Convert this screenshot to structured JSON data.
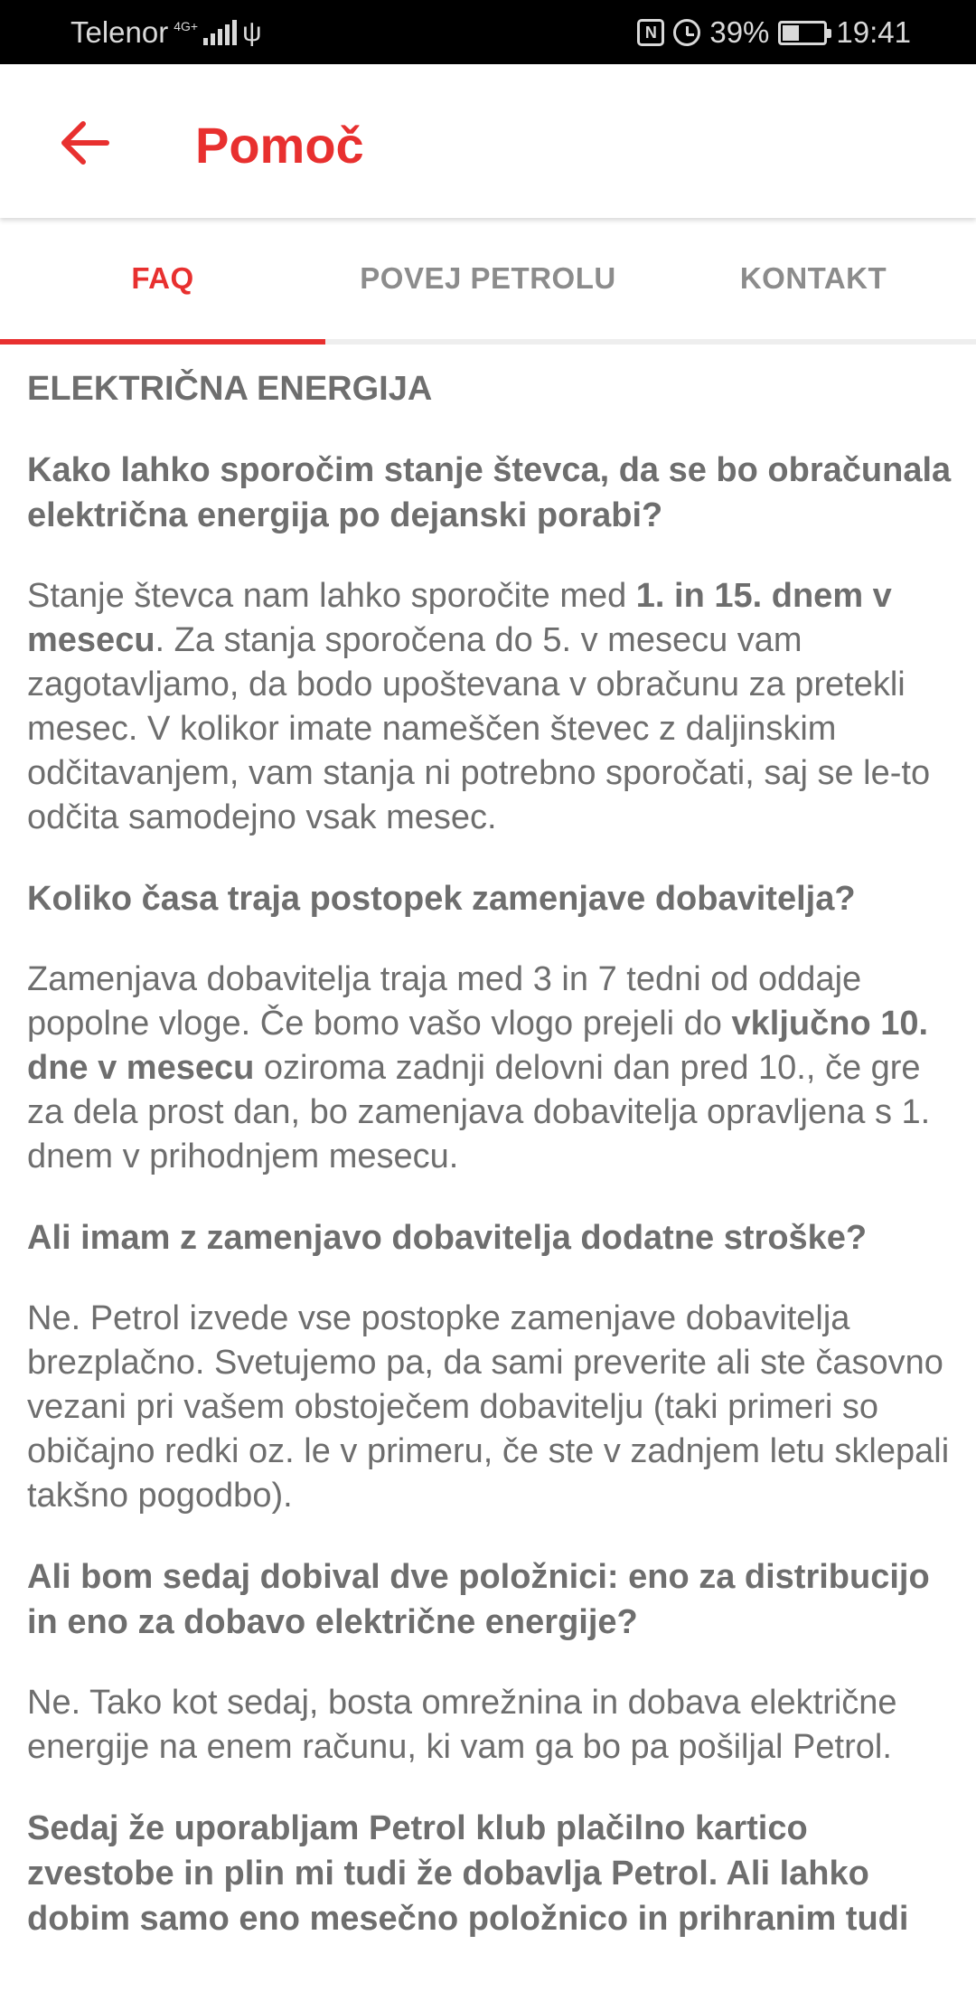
{
  "status_bar": {
    "carrier": "Telenor",
    "network": "4G+",
    "battery": "39%",
    "time": "19:41",
    "icons": [
      "signal-icon",
      "usb-icon",
      "nfc-icon",
      "alarm-icon",
      "battery-charging-icon"
    ]
  },
  "app_bar": {
    "title": "Pomoč",
    "accent_color": "#e8302f"
  },
  "tabs": [
    {
      "label": "FAQ",
      "active": true
    },
    {
      "label": "POVEJ PETROLU",
      "active": false
    },
    {
      "label": "KONTAKT",
      "active": false
    }
  ],
  "faq": {
    "section_title": "ELEKTRIČNA ENERGIJA",
    "q1": "Kako lahko sporočim stanje števca, da se bo obračunala električna energija po dejanski porabi?",
    "a1_part1": "Stanje števca nam lahko sporočite med ",
    "a1_bold": "1. in 15. dnem v mesecu",
    "a1_part2": ". Za stanja sporočena do 5. v mesecu vam zagotavljamo, da bodo upoštevana v obračunu za pretekli mesec. V kolikor imate nameščen števec z daljinskim odčitavanjem, vam stanja ni potrebno sporočati, saj se le-to odčita samodejno vsak mesec.",
    "q2": "Koliko časa traja postopek zamenjave dobavitelja?",
    "a2_part1": "Zamenjava dobavitelja traja med 3 in 7 tedni od oddaje popolne vloge. Če bomo vašo vlogo prejeli do ",
    "a2_bold": "vključno 10. dne v mesecu",
    "a2_part2": " oziroma zadnji delovni dan pred 10., če gre za dela prost dan, bo zamenjava dobavitelja opravljena s 1. dnem v prihodnjem mesecu.",
    "q3": "Ali imam z zamenjavo dobavitelja dodatne stroške?",
    "a3": "Ne. Petrol izvede vse postopke zamenjave dobavitelja brezplačno. Svetujemo pa, da sami preverite ali ste časovno vezani pri vašem obstoječem dobavitelju (taki primeri so običajno redki oz. le v primeru, če ste v zadnjem letu sklepali takšno pogodbo).",
    "q4": "Ali bom sedaj dobival dve položnici: eno za distribucijo in eno za dobavo električne energije?",
    "a4": "Ne. Tako kot sedaj, bosta omrežnina in dobava električne energije na enem računu, ki vam ga bo pa pošiljal Petrol.",
    "q5": "Sedaj že uporabljam Petrol klub plačilno kartico zvestobe in plin mi tudi že dobavlja Petrol. Ali lahko dobim samo eno mesečno položnico in prihranim tudi"
  }
}
